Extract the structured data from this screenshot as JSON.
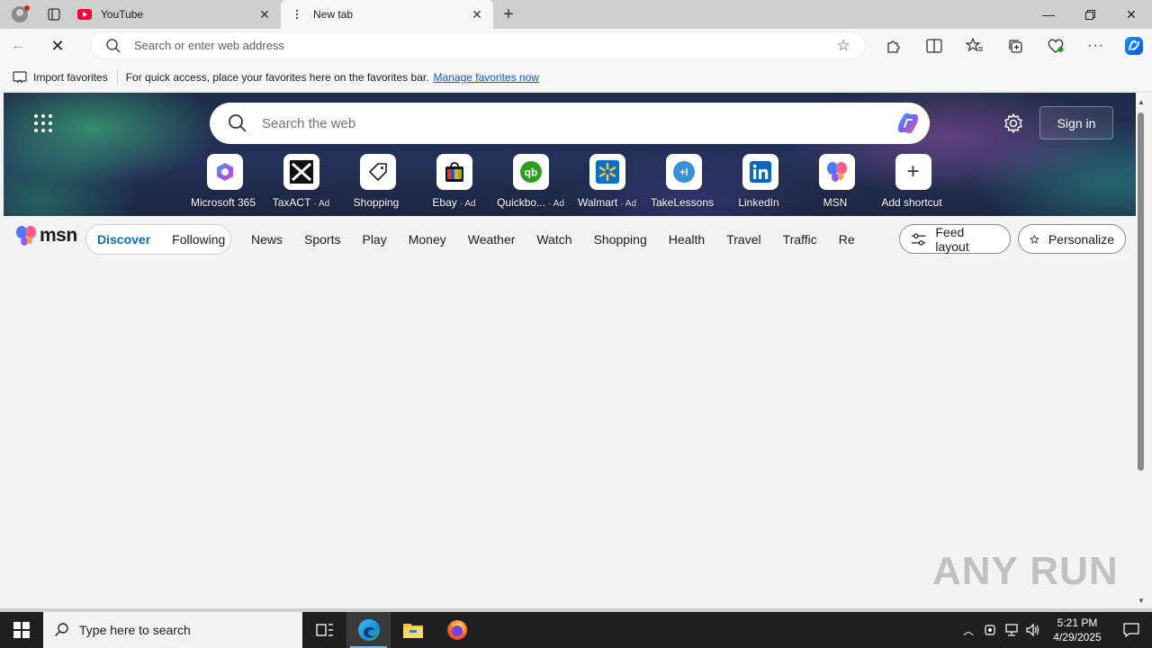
{
  "browser": {
    "tabs": [
      {
        "label": "YouTube",
        "active": false
      },
      {
        "label": "New tab",
        "active": true
      }
    ],
    "address": {
      "placeholder": "Search or enter web address",
      "value": ""
    },
    "favorites_bar": {
      "import_label": "Import favorites",
      "message": "For quick access, place your favorites here on the favorites bar.",
      "link_label": "Manage favorites now"
    }
  },
  "newtab": {
    "search_placeholder": "Search the web",
    "sign_in_label": "Sign in",
    "shortcuts": [
      {
        "name": "Microsoft 365",
        "ad": ""
      },
      {
        "name": "TaxACT",
        "ad": "· Ad"
      },
      {
        "name": "Shopping",
        "ad": ""
      },
      {
        "name": "Ebay",
        "ad": "· Ad"
      },
      {
        "name": "Quickbo...",
        "ad": "· Ad"
      },
      {
        "name": "Walmart",
        "ad": "· Ad"
      },
      {
        "name": "TakeLessons",
        "ad": ""
      },
      {
        "name": "LinkedIn",
        "ad": ""
      },
      {
        "name": "MSN",
        "ad": ""
      },
      {
        "name": "Add shortcut",
        "ad": ""
      }
    ],
    "msn": {
      "logo_text": "msn",
      "feed_tabs": [
        {
          "label": "Discover",
          "active": true
        },
        {
          "label": "Following",
          "active": false
        }
      ],
      "categories": [
        "News",
        "Sports",
        "Play",
        "Money",
        "Weather",
        "Watch",
        "Shopping",
        "Health",
        "Travel",
        "Traffic",
        "Real Estate"
      ],
      "feed_layout_label": "Feed layout",
      "personalize_label": "Personalize"
    }
  },
  "watermark": {
    "text": "ANY RUN"
  },
  "taskbar": {
    "search_placeholder": "Type here to search",
    "time": "5:21 PM",
    "date": "4/29/2025"
  },
  "colors": {
    "accent": "#0f6cbd",
    "link": "#0b57d0",
    "youtube_red": "#ff0033"
  }
}
